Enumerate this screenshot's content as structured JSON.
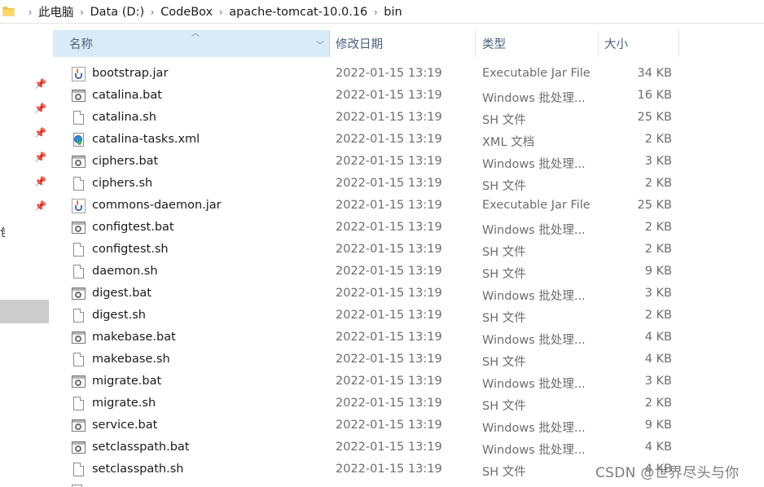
{
  "breadcrumb": {
    "items": [
      "此电脑",
      "Data (D:)",
      "CodeBox",
      "apache-tomcat-10.0.16",
      "bin"
    ],
    "separator": "›"
  },
  "columns": {
    "name": "名称",
    "date": "修改日期",
    "type": "类型",
    "size": "大小"
  },
  "nav": {
    "pins": 6,
    "fragment": "包"
  },
  "files": [
    {
      "name": "bootstrap.jar",
      "date": "2022-01-15 13:19",
      "type": "Executable Jar File",
      "size": "34 KB",
      "icon": "jar-icon"
    },
    {
      "name": "catalina.bat",
      "date": "2022-01-15 13:19",
      "type": "Windows 批处理...",
      "size": "16 KB",
      "icon": "bat-icon"
    },
    {
      "name": "catalina.sh",
      "date": "2022-01-15 13:19",
      "type": "SH 文件",
      "size": "25 KB",
      "icon": "file-icon"
    },
    {
      "name": "catalina-tasks.xml",
      "date": "2022-01-15 13:19",
      "type": "XML 文档",
      "size": "2 KB",
      "icon": "xml-icon"
    },
    {
      "name": "ciphers.bat",
      "date": "2022-01-15 13:19",
      "type": "Windows 批处理...",
      "size": "3 KB",
      "icon": "bat-icon"
    },
    {
      "name": "ciphers.sh",
      "date": "2022-01-15 13:19",
      "type": "SH 文件",
      "size": "2 KB",
      "icon": "file-icon"
    },
    {
      "name": "commons-daemon.jar",
      "date": "2022-01-15 13:19",
      "type": "Executable Jar File",
      "size": "25 KB",
      "icon": "jar-icon"
    },
    {
      "name": "configtest.bat",
      "date": "2022-01-15 13:19",
      "type": "Windows 批处理...",
      "size": "2 KB",
      "icon": "bat-icon"
    },
    {
      "name": "configtest.sh",
      "date": "2022-01-15 13:19",
      "type": "SH 文件",
      "size": "2 KB",
      "icon": "file-icon"
    },
    {
      "name": "daemon.sh",
      "date": "2022-01-15 13:19",
      "type": "SH 文件",
      "size": "9 KB",
      "icon": "file-icon"
    },
    {
      "name": "digest.bat",
      "date": "2022-01-15 13:19",
      "type": "Windows 批处理...",
      "size": "3 KB",
      "icon": "bat-icon"
    },
    {
      "name": "digest.sh",
      "date": "2022-01-15 13:19",
      "type": "SH 文件",
      "size": "2 KB",
      "icon": "file-icon"
    },
    {
      "name": "makebase.bat",
      "date": "2022-01-15 13:19",
      "type": "Windows 批处理...",
      "size": "4 KB",
      "icon": "bat-icon"
    },
    {
      "name": "makebase.sh",
      "date": "2022-01-15 13:19",
      "type": "SH 文件",
      "size": "4 KB",
      "icon": "file-icon"
    },
    {
      "name": "migrate.bat",
      "date": "2022-01-15 13:19",
      "type": "Windows 批处理...",
      "size": "3 KB",
      "icon": "bat-icon"
    },
    {
      "name": "migrate.sh",
      "date": "2022-01-15 13:19",
      "type": "SH 文件",
      "size": "2 KB",
      "icon": "file-icon"
    },
    {
      "name": "service.bat",
      "date": "2022-01-15 13:19",
      "type": "Windows 批处理...",
      "size": "9 KB",
      "icon": "bat-icon"
    },
    {
      "name": "setclasspath.bat",
      "date": "2022-01-15 13:19",
      "type": "Windows 批处理...",
      "size": "4 KB",
      "icon": "bat-icon"
    },
    {
      "name": "setclasspath.sh",
      "date": "2022-01-15 13:19",
      "type": "SH 文件",
      "size": "4 KB",
      "icon": "file-icon"
    }
  ],
  "watermark": "CSDN @世界尽头与你"
}
